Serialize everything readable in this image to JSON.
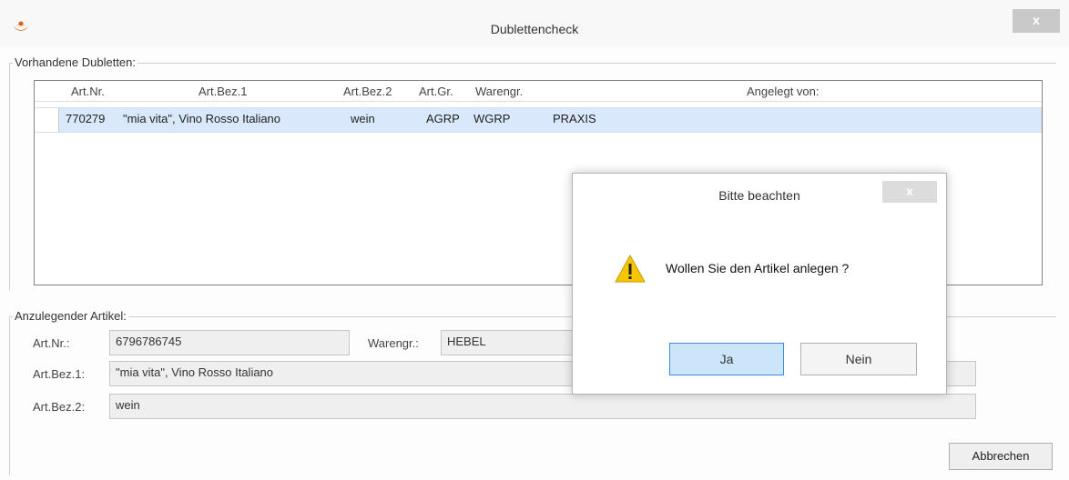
{
  "window": {
    "title": "Dublettencheck",
    "close_label": "x"
  },
  "duplicates": {
    "group_label": "Vorhandene Dubletten:",
    "columns": [
      "Art.Nr.",
      "Art.Bez.1",
      "Art.Bez.2",
      "Art.Gr.",
      "Warengr.",
      "Angelegt von:"
    ],
    "rows": [
      {
        "artnr": "770279",
        "bez1": "\"mia vita\", Vino Rosso Italiano",
        "bez2": "wein",
        "artgr": "AGRP",
        "warengr": "WGRP",
        "angelegt": "PRAXIS"
      }
    ]
  },
  "article": {
    "group_label": "Anzulegender Artikel:",
    "artnr_label": "Art.Nr.:",
    "artnr_value": "6796786745",
    "warengr_label": "Warengr.:",
    "warengr_value": "HEBEL",
    "bez1_label": "Art.Bez.1:",
    "bez1_value": "\"mia vita\", Vino Rosso Italiano",
    "bez2_label": "Art.Bez.2:",
    "bez2_value": "wein"
  },
  "buttons": {
    "abbrechen": "Abbrechen"
  },
  "dialog": {
    "title": "Bitte beachten",
    "close_label": "x",
    "message": "Wollen Sie den Artikel anlegen ?",
    "yes_label": "Ja",
    "no_label": "Nein",
    "icon": "warning-icon"
  }
}
